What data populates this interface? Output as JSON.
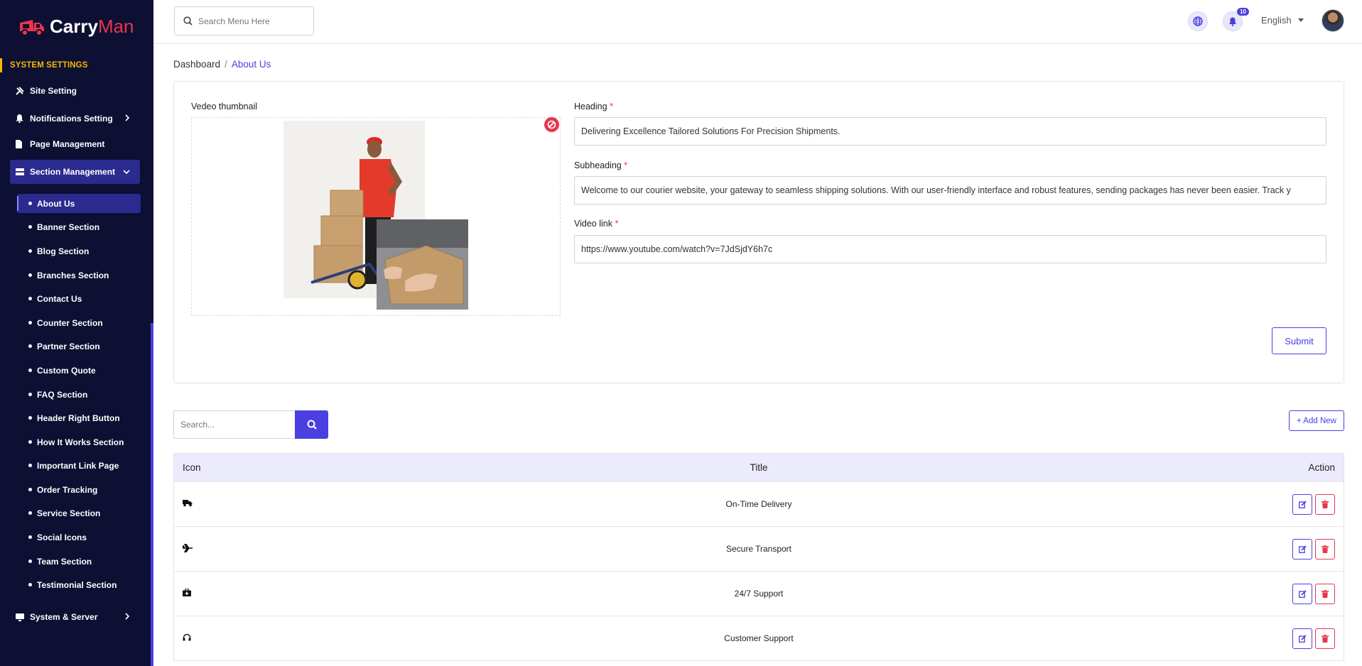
{
  "app": {
    "brand_part1": "Carry",
    "brand_part2": "Man"
  },
  "colors": {
    "sidebar_bg": "#0d0f33",
    "accent": "#4b3fe0",
    "danger": "#e8354b",
    "section_heading": "#f5b800"
  },
  "sidebar": {
    "section_heading": "SYSTEM SETTINGS",
    "items": [
      {
        "label": "Site Setting",
        "icon": "tools-icon"
      },
      {
        "label": "Notifications Setting",
        "icon": "bell-icon"
      },
      {
        "label": "Page Management",
        "icon": "file-icon"
      },
      {
        "label": "Section Management",
        "icon": "section-icon"
      }
    ],
    "sub_items": [
      "About Us",
      "Banner Section",
      "Blog Section",
      "Branches Section",
      "Contact Us",
      "Counter Section",
      "Partner Section",
      "Custom Quote",
      "FAQ Section",
      "Header Right Button",
      "How It Works Section",
      "Important Link Page",
      "Order Tracking",
      "Service Section",
      "Social Icons",
      "Team Section",
      "Testimonial Section"
    ],
    "bottom_item": {
      "label": "System & Server",
      "icon": "monitor-icon"
    }
  },
  "header": {
    "search_placeholder": "Search Menu Here",
    "notification_count": "10",
    "language": "English"
  },
  "breadcrumb": {
    "root": "Dashboard",
    "current": "About Us"
  },
  "form": {
    "thumbnail_label": "Vedeo thumbnail",
    "heading_label": "Heading",
    "heading_value": "Delivering Excellence Tailored Solutions For Precision Shipments.",
    "subheading_label": "Subheading",
    "subheading_value": "Welcome to our courier website, your gateway to seamless shipping solutions. With our user-friendly interface and robust features, sending packages has never been easier. Track y",
    "video_label": "Video link",
    "video_value": "https://www.youtube.com/watch?v=7JdSjdY6h7c",
    "required_mark": "*",
    "submit_label": "Submit"
  },
  "table": {
    "search_placeholder": "Search...",
    "add_new_label": "+ Add New",
    "headers": {
      "icon": "Icon",
      "title": "Title",
      "action": "Action"
    },
    "rows": [
      {
        "icon": "truck-icon",
        "title": "On-Time Delivery"
      },
      {
        "icon": "plane-icon",
        "title": "Secure Transport"
      },
      {
        "icon": "medkit-icon",
        "title": "24/7 Support"
      },
      {
        "icon": "headset-icon",
        "title": "Customer Support"
      }
    ]
  }
}
